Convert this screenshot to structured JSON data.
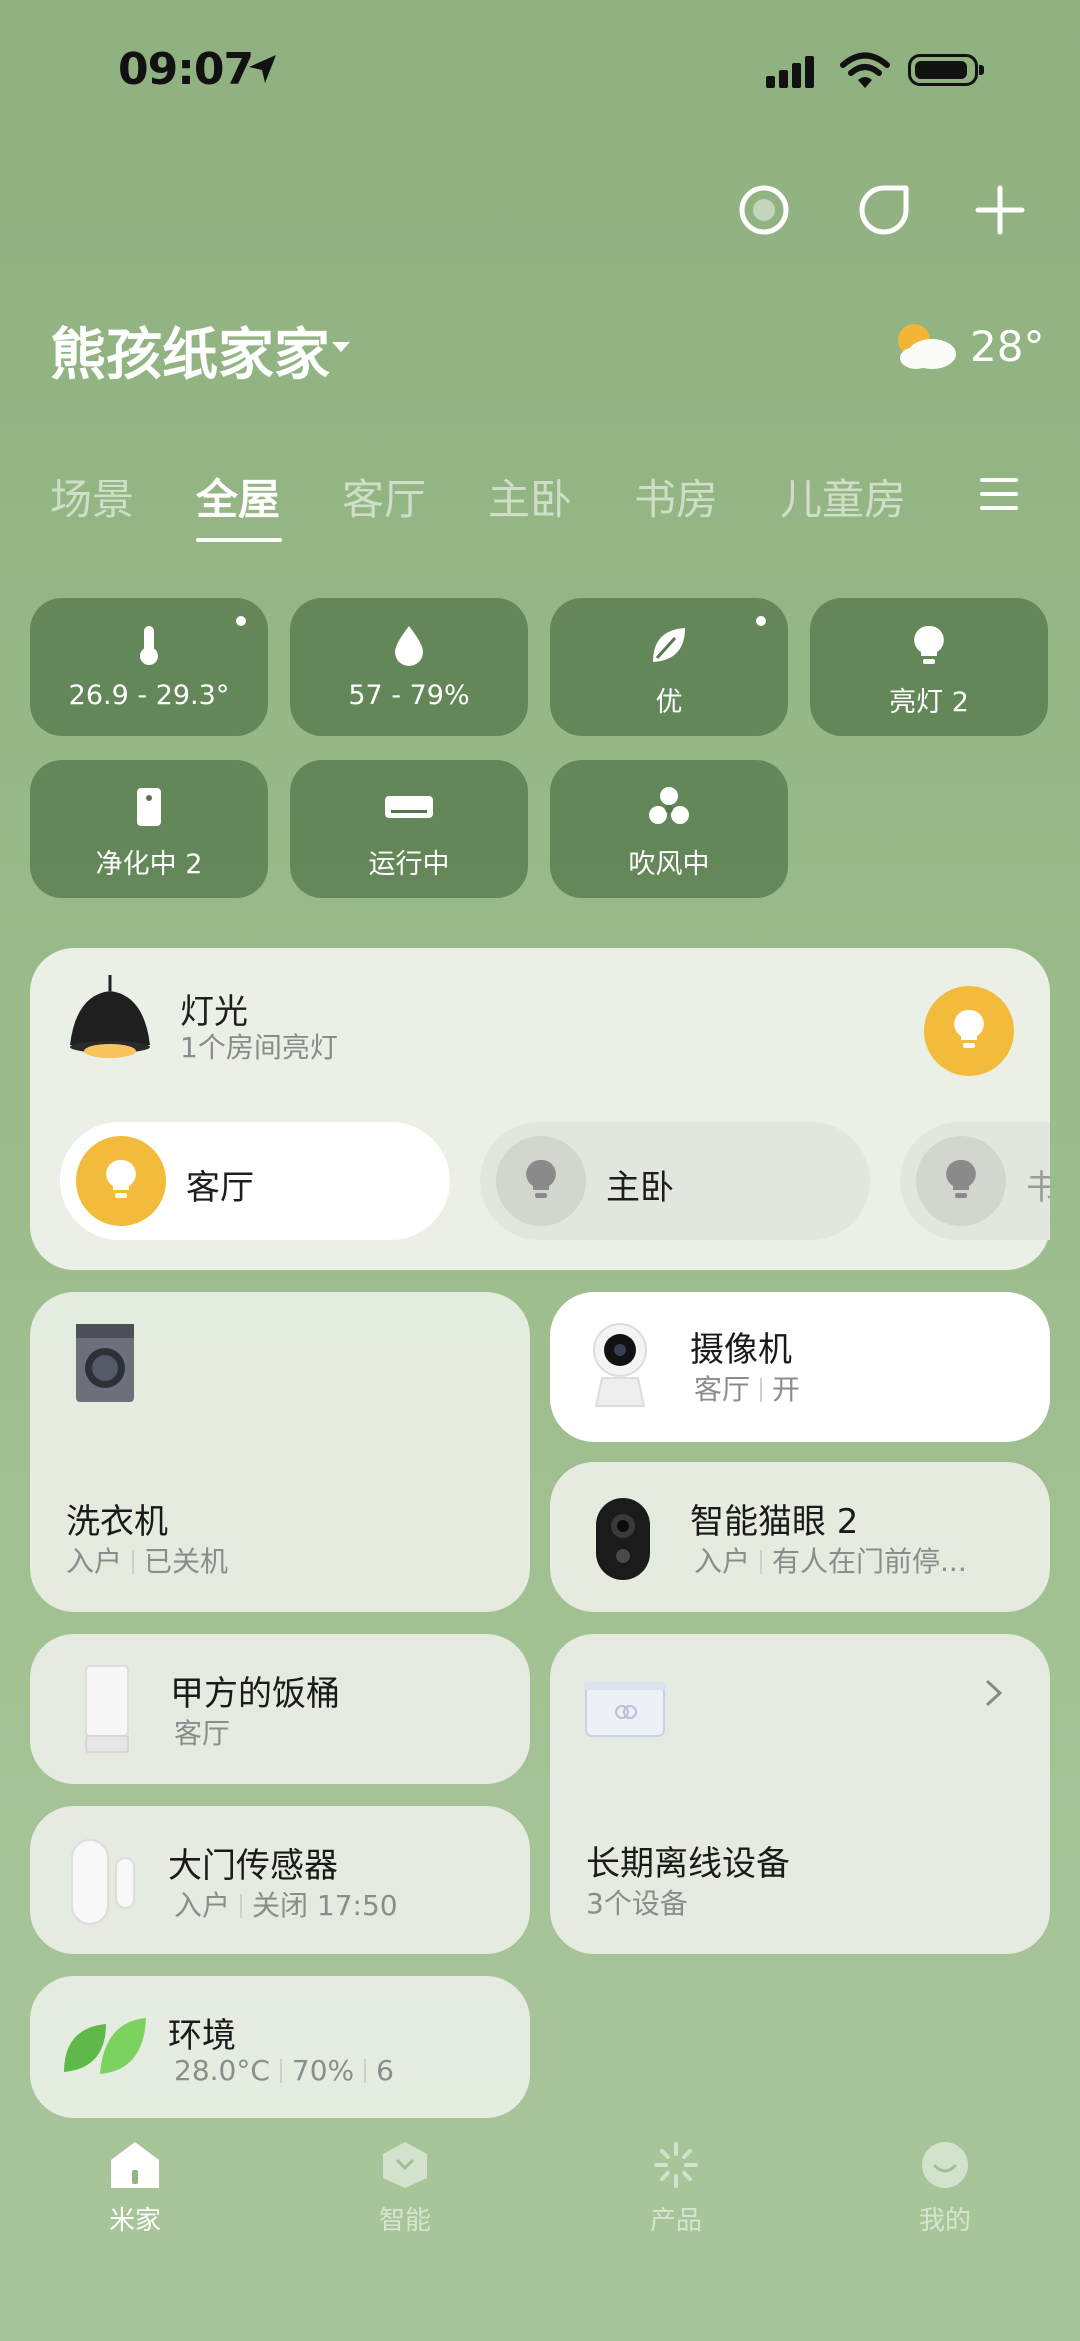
{
  "status_bar": {
    "time": "09:07"
  },
  "header": {
    "home_name": "熊孩纸家家",
    "temperature": "28°"
  },
  "tabs": [
    {
      "label": "场景"
    },
    {
      "label": "全屋",
      "active": true
    },
    {
      "label": "客厅"
    },
    {
      "label": "主卧"
    },
    {
      "label": "书房"
    },
    {
      "label": "儿童房"
    }
  ],
  "status_chips": [
    {
      "icon": "thermometer-icon",
      "label": "26.9 - 29.3°",
      "dot": true
    },
    {
      "icon": "humidity-drop-icon",
      "label": "57 - 79%"
    },
    {
      "icon": "leaf-icon",
      "label": "优",
      "dot": true
    },
    {
      "icon": "bulb-icon",
      "label": "亮灯 2"
    },
    {
      "icon": "purifier-icon",
      "label": "净化中 2"
    },
    {
      "icon": "air-conditioner-icon",
      "label": "运行中"
    },
    {
      "icon": "fan-icon",
      "label": "吹风中"
    }
  ],
  "lighting": {
    "title": "灯光",
    "subtitle": "1个房间亮灯",
    "rooms": [
      {
        "name": "客厅",
        "on": true
      },
      {
        "name": "主卧",
        "on": false
      },
      {
        "name": "书",
        "on": false
      }
    ]
  },
  "devices": {
    "washer": {
      "name": "洗衣机",
      "room": "入户",
      "state": "已关机"
    },
    "camera": {
      "name": "摄像机",
      "room": "客厅",
      "state": "开"
    },
    "doorbell": {
      "name": "智能猫眼 2",
      "room": "入户",
      "state": "有人在门前停..."
    },
    "rice": {
      "name": "甲方的饭桶",
      "room": "客厅"
    },
    "offline": {
      "name": "长期离线设备",
      "count": "3个设备"
    },
    "door_sensor": {
      "name": "大门传感器",
      "room": "入户",
      "state": "关闭 17:50"
    },
    "env": {
      "name": "环境",
      "temp": "28.0°C",
      "humidity": "70%",
      "value": "6"
    }
  },
  "bottom_nav": [
    {
      "label": "米家",
      "active": true
    },
    {
      "label": "智能"
    },
    {
      "label": "产品"
    },
    {
      "label": "我的"
    }
  ],
  "colors": {
    "accent_yellow": "#f3bb3b",
    "chip_bg": "#54774b"
  }
}
